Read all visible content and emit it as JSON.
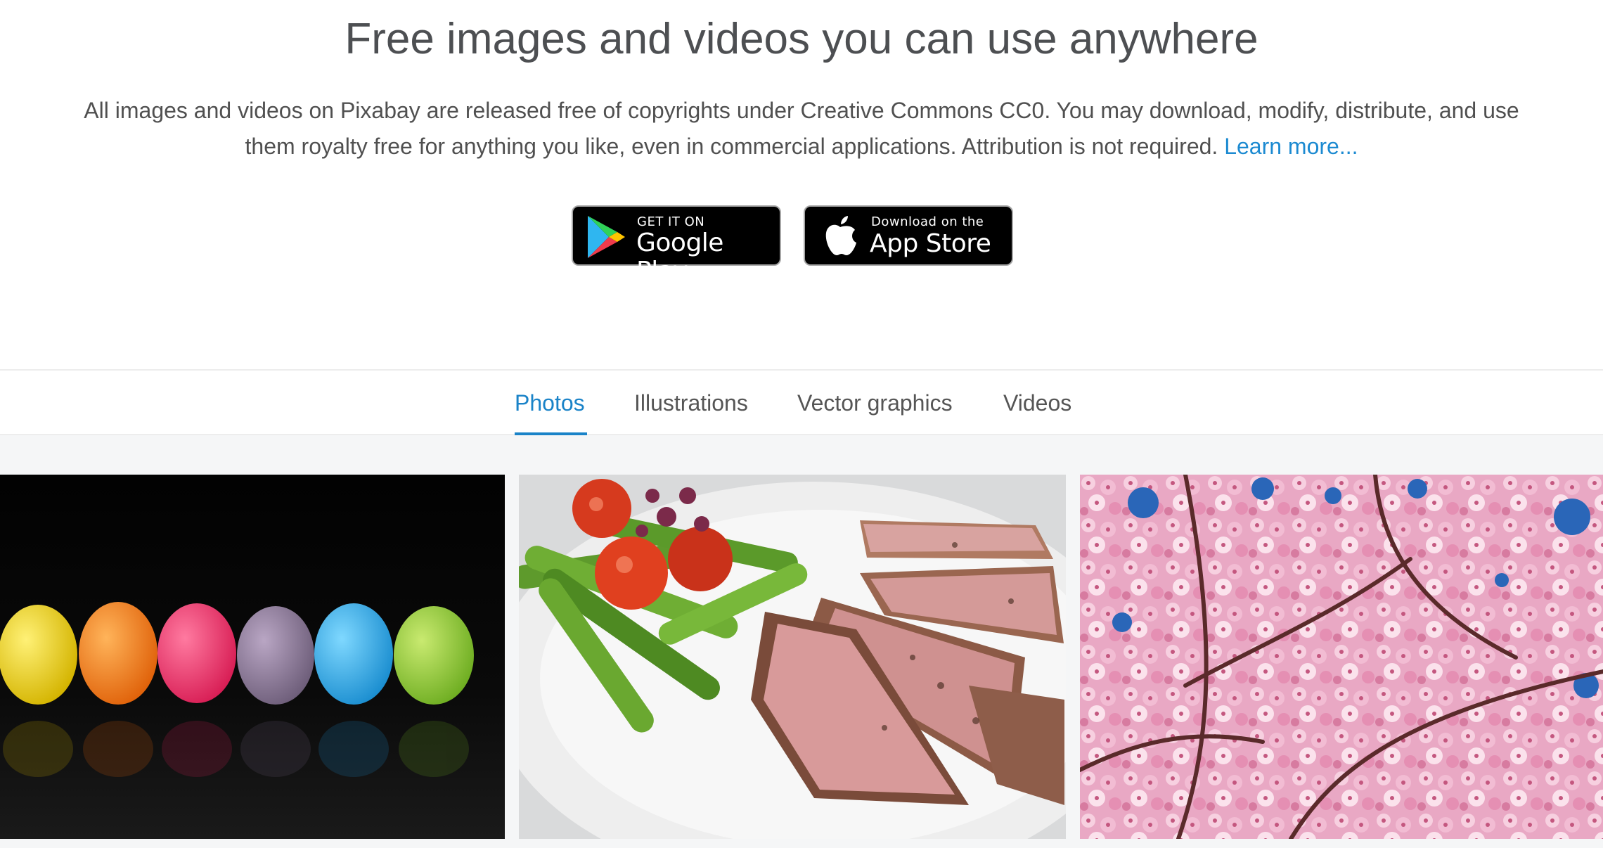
{
  "hero": {
    "title": "Free images and videos you can use anywhere",
    "description": "All images and videos on Pixabay are released free of copyrights under Creative Commons CC0. You may download, modify, distribute, and use them royalty free for anything you like, even in commercial applications. Attribution is not required.",
    "learn_more": "Learn more..."
  },
  "stores": {
    "google_play": {
      "small": "GET IT ON",
      "big": "Google Play"
    },
    "app_store": {
      "small": "Download on the",
      "big": "App Store"
    }
  },
  "tabs": [
    {
      "label": "Photos",
      "active": true
    },
    {
      "label": "Illustrations",
      "active": false
    },
    {
      "label": "Vector graphics",
      "active": false
    },
    {
      "label": "Videos",
      "active": false
    }
  ],
  "colors": {
    "accent": "#1a83c8",
    "link": "#1c8ad1",
    "text": "#4d4f52"
  },
  "photos": [
    {
      "subject": "colorful-easter-eggs"
    },
    {
      "subject": "steak-asparagus-tomatoes"
    },
    {
      "subject": "pink-cherry-blossoms"
    }
  ]
}
